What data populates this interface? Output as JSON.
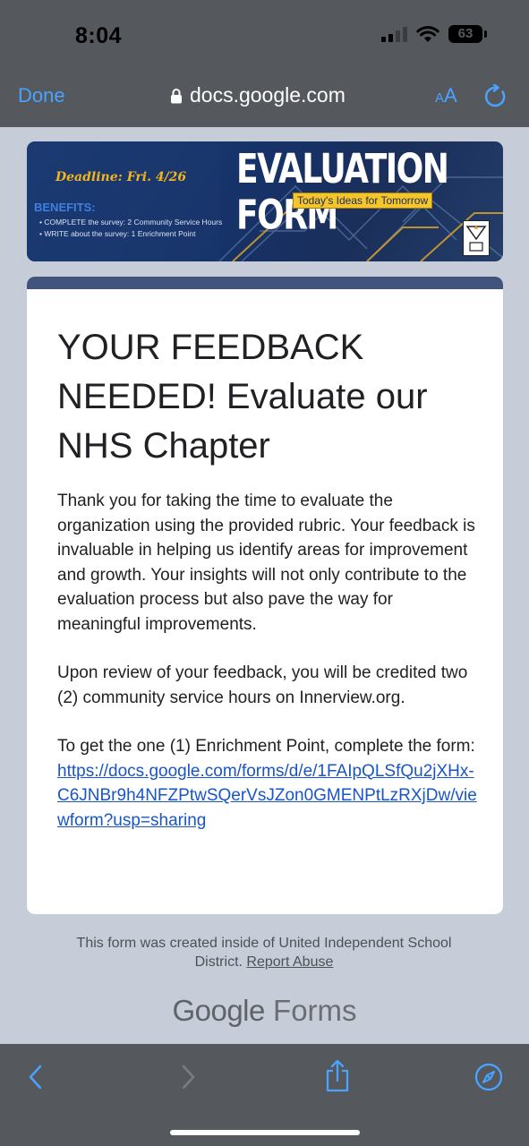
{
  "status_bar": {
    "time": "8:04",
    "battery": "63"
  },
  "browser": {
    "done_label": "Done",
    "url": "docs.google.com",
    "text_size_small": "A",
    "text_size_large": "A"
  },
  "banner": {
    "deadline_label": "Deadline:",
    "deadline_date": "Fri. 4/26",
    "title": "EVALUATION FORM",
    "tagline": "Today's Ideas for Tomorrow",
    "benefits_title": "BENEFITS:",
    "benefits": [
      "• COMPLETE the survey:  2 Community Service Hours",
      "• WRITE about the survey:  1 Enrichment Point"
    ]
  },
  "form": {
    "title": "YOUR FEEDBACK NEEDED!  Evaluate our NHS Chapter",
    "paragraph1": "Thank you for taking the time to evaluate the organization using the provided rubric. Your feedback is invaluable in helping us identify areas for improvement and growth.  Your insights will not only contribute to the evaluation process but also pave the way for meaningful improvements.",
    "paragraph2": "Upon review of your feedback, you will be credited two (2) community service hours on Innerview.org.",
    "paragraph3_prefix": "To get the one (1) Enrichment Point, complete the form:",
    "link": "https://docs.google.com/forms/d/e/1FAIpQLSfQu2jXHx-C6JNBr9h4NFZPtwSQerVsJZon0GMENPtLzRXjDw/viewform?usp=sharing"
  },
  "footer": {
    "created_text": "This form was created inside of United Independent School District.",
    "report_abuse": "Report Abuse",
    "brand_google": "Google",
    "brand_forms": "Forms"
  },
  "colors": {
    "accent": "#4aa3ff",
    "card_header": "#40547e",
    "page_bg": "#c7cdd8",
    "link": "#1a55c8"
  }
}
